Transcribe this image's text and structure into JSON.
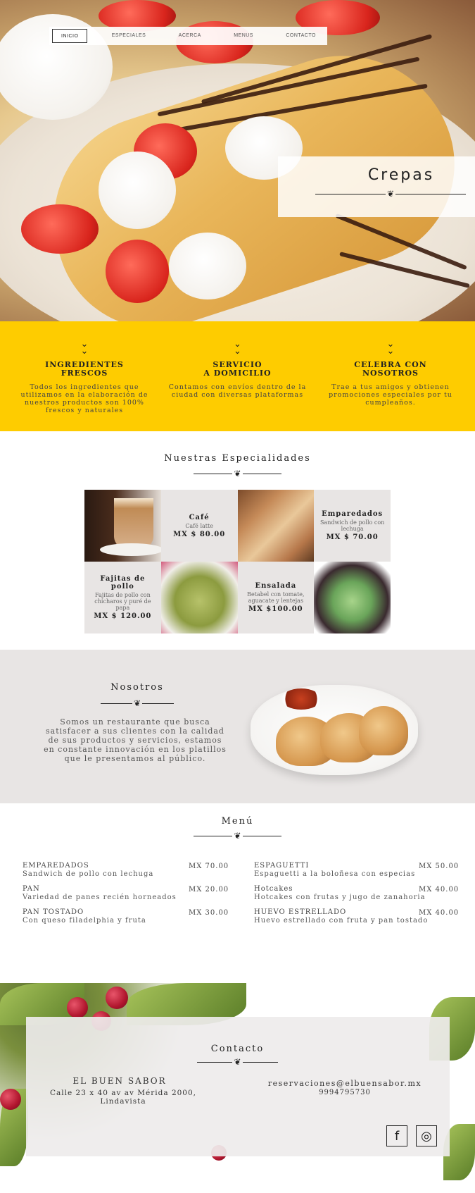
{
  "nav": {
    "items": [
      {
        "label": "INICIO",
        "active": true
      },
      {
        "label": "ESPECIALES"
      },
      {
        "label": "ACERCA"
      },
      {
        "label": "MENUS"
      },
      {
        "label": "CONTACTO"
      }
    ]
  },
  "hero": {
    "title": "Crepas"
  },
  "features": [
    {
      "icon": "chevron-double-down-icon",
      "title": "INGREDIENTES\nFRESCOS",
      "text": "Todos los ingredientes que utilizamos en la elaboración de nuestros productos son 100% frescos y naturales"
    },
    {
      "icon": "chevron-double-down-icon",
      "title": "SERVICIO\nA DOMICILIO",
      "text": "Contamos con envíos dentro de la ciudad con diversas plataformas"
    },
    {
      "icon": "chevron-double-down-icon",
      "title": "CELEBRA CON\nNOSOTROS",
      "text": "Trae a tus amigos y obtienen promociones especiales por tu cumpleaños."
    }
  ],
  "specialties": {
    "title": "Nuestras Especialidades",
    "items": [
      {
        "name": "Café",
        "desc": "Café latte",
        "price": "MX $ 80.00"
      },
      {
        "name": "Emparedados",
        "desc": "Sandwich de pollo con lechuga",
        "price": "MX $ 70.00"
      },
      {
        "name": "Fajitas de pollo",
        "desc": "Fajitas de pollo con chícharos y puré de papa",
        "price": "MX $ 120.00"
      },
      {
        "name": "Ensalada",
        "desc": "Betabel con tomate, aguacate y lentejas",
        "price": "MX $100.00"
      }
    ]
  },
  "about": {
    "title": "Nosotros",
    "text": "Somos un restaurante que busca satisfacer a sus clientes con la calidad de sus productos y servicios, estamos en constante innovación en los platillos que le presentamos al público."
  },
  "menu": {
    "title": "Menú",
    "left": [
      {
        "name": "EMPAREDADOS",
        "desc": "Sandwich de pollo con lechuga",
        "price": "MX 70.00"
      },
      {
        "name": "PAN",
        "desc": "Variedad de panes recién horneados",
        "price": "MX 20.00"
      },
      {
        "name": "PAN TOSTADO",
        "desc": "Con queso filadelphia y fruta",
        "price": "MX 30.00"
      }
    ],
    "right": [
      {
        "name": "ESPAGUETTI",
        "desc": "Espaguetti a la boloñesa con especias",
        "price": "MX 50.00"
      },
      {
        "name": "Hotcakes",
        "desc": "Hotcakes con frutas y jugo de zanahoria",
        "price": "MX 40.00"
      },
      {
        "name": "HUEVO ESTRELLADO",
        "desc": "Huevo estrellado con fruta y pan tostado",
        "price": "MX 40.00"
      }
    ]
  },
  "contact": {
    "title": "Contacto",
    "brand": "EL BUEN SABOR",
    "address": "Calle 23 x 40 av av Mérida 2000, Lindavista",
    "email": "reservaciones@elbuensabor.mx",
    "phone": "9994795730",
    "social": [
      {
        "name": "facebook-icon",
        "glyph": "f"
      },
      {
        "name": "instagram-icon",
        "glyph": "◎"
      }
    ]
  }
}
